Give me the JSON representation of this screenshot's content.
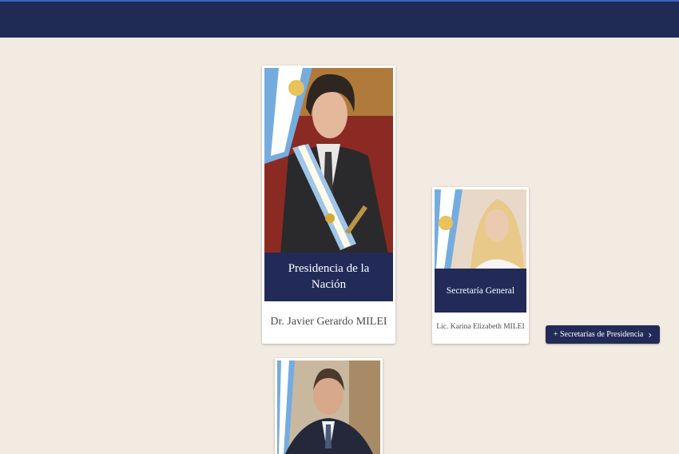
{
  "cards": {
    "president": {
      "title": "Presidencia de la Nación",
      "name": "Dr. Javier Gerardo MILEI"
    },
    "secretaria": {
      "title": "Secretaría General",
      "name": "Lic. Karina Elizabeth MILEI"
    },
    "third": {}
  },
  "more_button": {
    "label": "+ Secretarías de Presidencia",
    "icon": "chevron-right-icon"
  },
  "colors": {
    "navbar": "#1f2a55",
    "band": "#222b58",
    "background": "#f2ebe2"
  }
}
